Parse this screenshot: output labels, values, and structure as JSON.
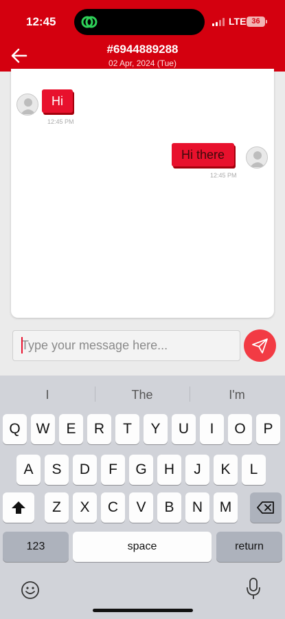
{
  "status_bar": {
    "time": "12:45",
    "network": "LTE",
    "battery": "36"
  },
  "header": {
    "title": "#6944889288",
    "date": "02 Apr, 2024 (Tue)"
  },
  "messages": [
    {
      "text": "Hi",
      "time": "12:45 PM",
      "direction": "received"
    },
    {
      "text": "Hi there",
      "time": "12:45 PM",
      "direction": "sent"
    }
  ],
  "composer": {
    "placeholder": "Type your message here..."
  },
  "keyboard": {
    "suggestions": [
      "I",
      "The",
      "I'm"
    ],
    "row1": [
      "Q",
      "W",
      "E",
      "R",
      "T",
      "Y",
      "U",
      "I",
      "O",
      "P"
    ],
    "row2": [
      "A",
      "S",
      "D",
      "F",
      "G",
      "H",
      "J",
      "K",
      "L"
    ],
    "row3": [
      "Z",
      "X",
      "C",
      "V",
      "B",
      "N",
      "M"
    ],
    "numbers_label": "123",
    "space_label": "space",
    "return_label": "return"
  },
  "colors": {
    "brand_red": "#d4000f",
    "bubble_red": "#e8112d",
    "send_red": "#f23b44"
  },
  "icons": [
    "app-link-icon",
    "back-arrow-icon",
    "user-avatar-icon",
    "send-icon",
    "shift-icon",
    "backspace-icon",
    "emoji-icon",
    "microphone-icon"
  ]
}
